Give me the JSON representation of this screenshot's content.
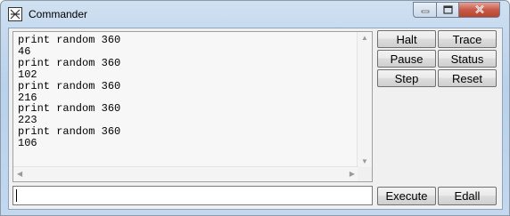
{
  "window": {
    "title": "Commander"
  },
  "icons": {
    "app": "commander-app-icon",
    "minimize": "minimize-icon",
    "maximize": "maximize-icon",
    "close": "close-icon"
  },
  "output": {
    "lines": [
      "print random 360",
      "46",
      "print random 360",
      "102",
      "print random 360",
      "216",
      "print random 360",
      "223",
      "print random 360",
      "106"
    ]
  },
  "buttons": {
    "halt": "Halt",
    "trace": "Trace",
    "pause": "Pause",
    "status": "Status",
    "step": "Step",
    "reset": "Reset",
    "execute": "Execute",
    "edall": "Edall"
  },
  "input": {
    "value": ""
  },
  "colors": {
    "close_button": "#c75a48",
    "titlebar": "#b9d1ea"
  }
}
